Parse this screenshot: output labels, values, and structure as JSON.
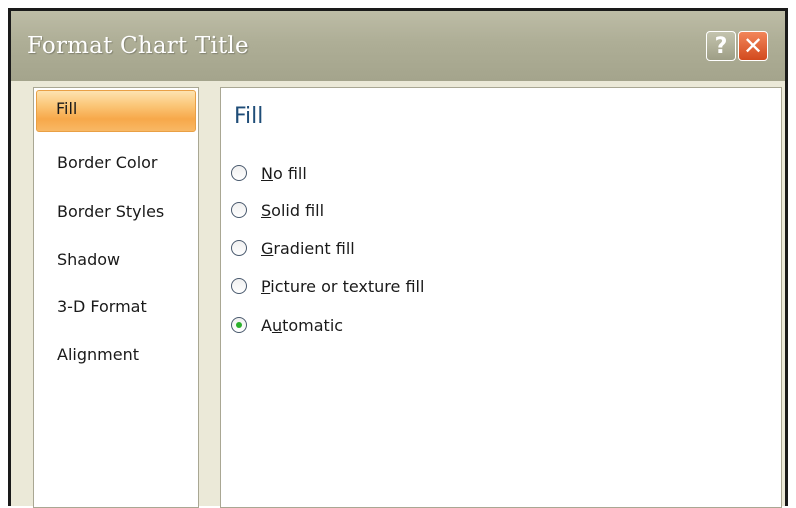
{
  "dialog": {
    "title": "Format Chart Title",
    "help_label": "?",
    "close_label": "✕"
  },
  "sidebar": {
    "items": [
      {
        "label": "Fill",
        "selected": true
      },
      {
        "label": "Border Color",
        "selected": false
      },
      {
        "label": "Border Styles",
        "selected": false
      },
      {
        "label": "Shadow",
        "selected": false
      },
      {
        "label": "3-D Format",
        "selected": false
      },
      {
        "label": "Alignment",
        "selected": false
      }
    ]
  },
  "panel": {
    "title": "Fill",
    "options": [
      {
        "accel": "N",
        "rest": "o fill",
        "checked": false
      },
      {
        "accel": "S",
        "rest": "olid fill",
        "checked": false
      },
      {
        "accel": "G",
        "rest": "radient fill",
        "checked": false
      },
      {
        "accel": "P",
        "rest": "icture or texture fill",
        "checked": false
      },
      {
        "pre": "A",
        "accel": "u",
        "rest": "tomatic",
        "checked": true
      }
    ]
  },
  "colors": {
    "accent_selected": "#f7a84a",
    "radio_checked": "#2bb02b",
    "title_text": "#1f4d78",
    "close_button": "#d24a1e"
  }
}
